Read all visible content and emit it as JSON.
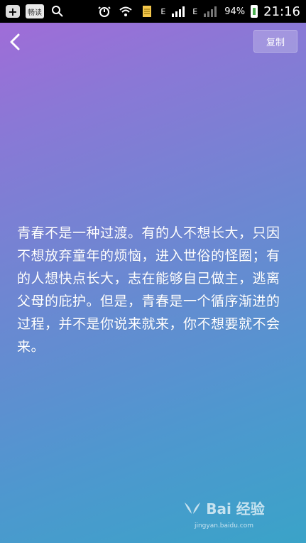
{
  "statusbar": {
    "app_label": "畅读",
    "signal_tag_1": "E",
    "signal_tag_2": "E",
    "battery": "94%",
    "time": "21:16"
  },
  "header": {
    "copy_label": "复制"
  },
  "content": {
    "text": "青春不是一种过渡。有的人不想长大，只因不想放弃童年的烦恼，进入世俗的怪圈；有的人想快点长大，志在能够自己做主，逃离父母的庇护。但是，青春是一个循序渐进的过程，并不是你说来就来，你不想要就不会来。"
  },
  "watermark": {
    "brand": "Bai 经验",
    "url": "jingyan.baidu.com"
  },
  "colors": {
    "gradient_top": "#a46ad8",
    "gradient_bottom": "#3aa3c8"
  }
}
